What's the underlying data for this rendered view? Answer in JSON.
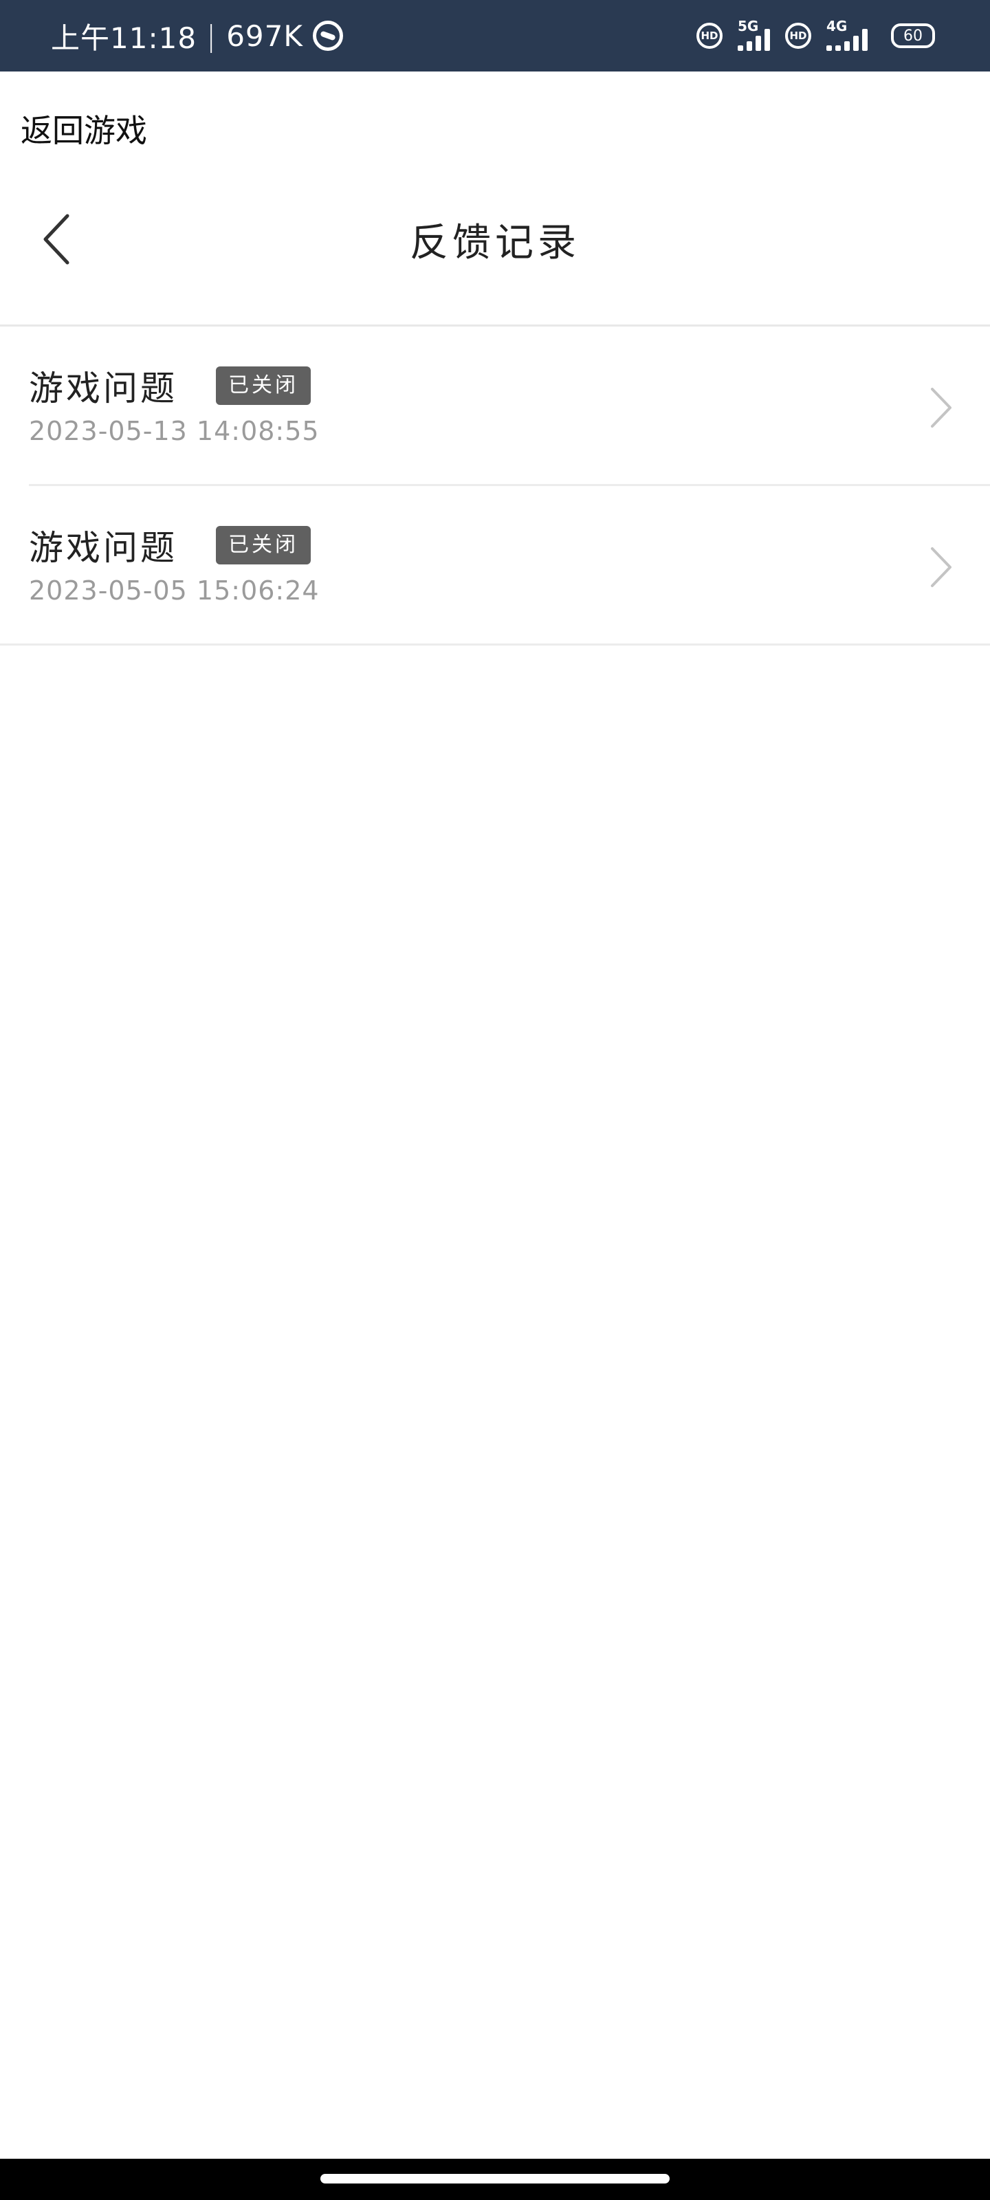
{
  "status_bar": {
    "time": "上午11:18",
    "separator": "|",
    "speed": "697K",
    "hd_1": "HD",
    "net_1": "5G",
    "hd_2": "HD",
    "net_2": "4G",
    "battery": "60"
  },
  "top_link": "返回游戏",
  "header": {
    "title": "反馈记录"
  },
  "records": [
    {
      "category": "游戏问题",
      "status": "已关闭",
      "time": "2023-05-13 14:08:55"
    },
    {
      "category": "游戏问题",
      "status": "已关闭",
      "time": "2023-05-05 15:06:24"
    }
  ]
}
